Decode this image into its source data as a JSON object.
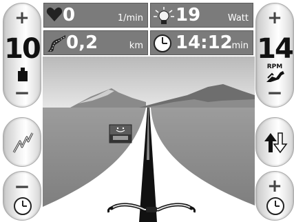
{
  "left_panel": {
    "resistance": {
      "plus_label": "+",
      "value": "10",
      "minus_label": "−",
      "icon": "weight-icon"
    },
    "mode_button": {
      "icon": "lightning-icon"
    },
    "time_minus_button": {
      "label": "−",
      "icon": "clock-icon"
    }
  },
  "right_panel": {
    "cadence": {
      "plus_label": "+",
      "value": "14",
      "unit": "RPM",
      "minus_label": "−",
      "icon": "rabbit-icon"
    },
    "direction_button": {
      "icon": "up-down-arrows-icon"
    },
    "time_plus_button": {
      "label": "+",
      "icon": "clock-icon"
    }
  },
  "stats": {
    "heart_rate": {
      "value": "0",
      "unit": "1/min",
      "icon": "heart-icon"
    },
    "power": {
      "value": "19",
      "unit": "Watt",
      "icon": "lightbulb-icon"
    },
    "distance": {
      "value": "0,2",
      "unit": "km",
      "icon": "road-icon"
    },
    "time": {
      "value": "14:12",
      "unit": "min",
      "icon": "clock-icon"
    }
  },
  "scene": {
    "sign": {
      "icon": "smiley-icon"
    },
    "handlebar": {
      "icon": "handlebar-icon"
    }
  },
  "colors": {
    "stat_bg": "#7b7b7b",
    "heart": "#222222"
  }
}
